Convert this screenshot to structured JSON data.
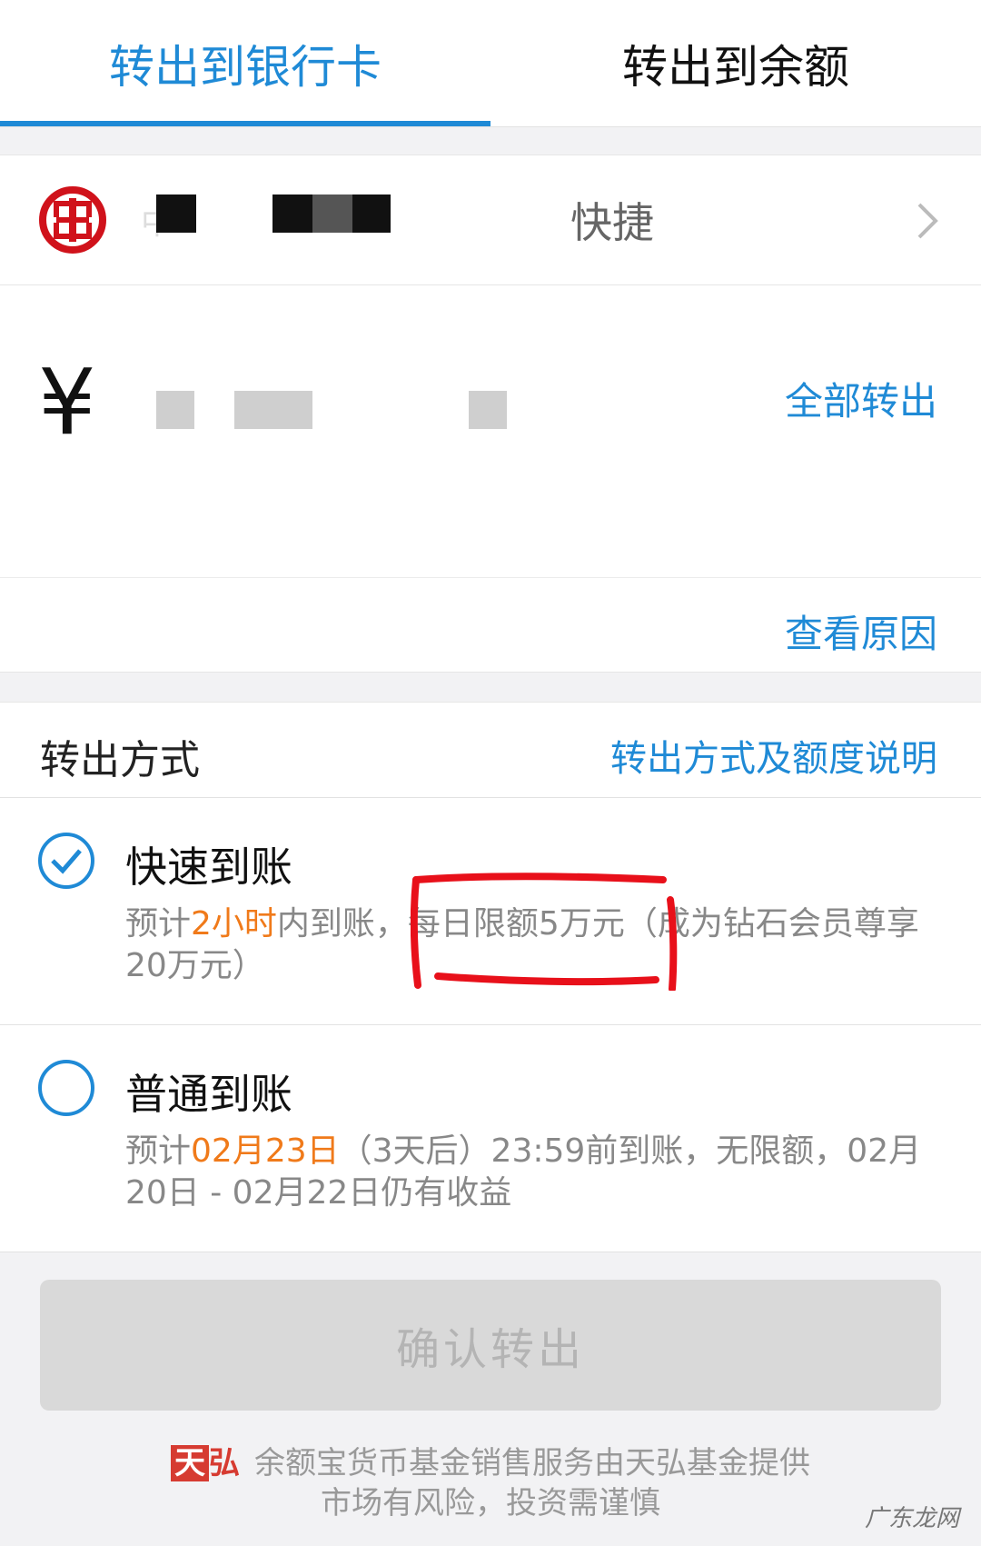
{
  "tabs": [
    {
      "label": "转出到银行卡",
      "active": true
    },
    {
      "label": "转出到余额",
      "active": false
    }
  ],
  "bank": {
    "name_fragment": "中",
    "quick_label": "快捷"
  },
  "amount": {
    "currency_symbol": "¥",
    "withdraw_all_label": "全部转出"
  },
  "reason": {
    "view_reason_label": "查看原因"
  },
  "method": {
    "title": "转出方式",
    "desc_link": "转出方式及额度说明",
    "options": [
      {
        "title": "快速到账",
        "selected": true,
        "detail_prefix": "预计",
        "detail_highlight": "2小时",
        "detail_suffix": "内到账，每日限额5万元（成为钻石会员尊享20万元）"
      },
      {
        "title": "普通到账",
        "selected": false,
        "detail_prefix": "预计",
        "detail_highlight": "02月23日",
        "detail_suffix": "（3天后）23:59前到账，无限额，02月20日 - 02月22日仍有收益"
      }
    ]
  },
  "confirm_button": "确认转出",
  "footer": {
    "logo_tian": "天",
    "logo_hong": "弘",
    "line1": "余额宝货币基金销售服务由天弘基金提供",
    "line2": "市场有风险，投资需谨慎"
  },
  "watermark": "广东龙网",
  "colors": {
    "accent": "#1f8ad6",
    "highlight": "#f07a1a",
    "annotation": "#e8101a",
    "bank_red": "#d0121b"
  }
}
